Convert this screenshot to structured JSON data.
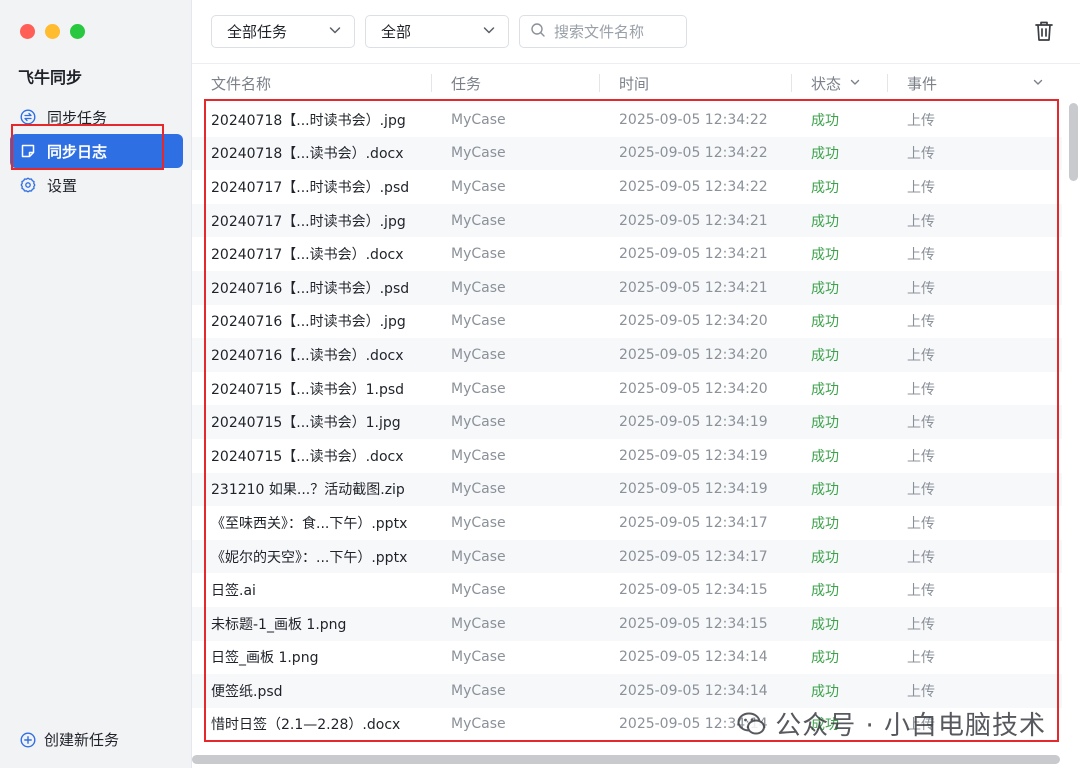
{
  "app": {
    "title": "飞牛同步"
  },
  "sidebar": {
    "items": [
      {
        "label": "同步任务",
        "icon": "sync-circle-icon",
        "active": false
      },
      {
        "label": "同步日志",
        "icon": "log-note-icon",
        "active": true
      },
      {
        "label": "设置",
        "icon": "gear-icon",
        "active": false
      }
    ],
    "create_label": "创建新任务"
  },
  "toolbar": {
    "task_filter": "全部任务",
    "status_filter": "全部",
    "search_placeholder": "搜索文件名称"
  },
  "table": {
    "columns": [
      "文件名称",
      "任务",
      "时间",
      "状态",
      "事件"
    ],
    "rows": [
      {
        "name": "20240718【...时读书会）.jpg",
        "task": "MyCase",
        "time": "2025-09-05 12:34:22",
        "status": "成功",
        "event": "上传"
      },
      {
        "name": "20240718【...读书会）.docx",
        "task": "MyCase",
        "time": "2025-09-05 12:34:22",
        "status": "成功",
        "event": "上传"
      },
      {
        "name": "20240717【...时读书会）.psd",
        "task": "MyCase",
        "time": "2025-09-05 12:34:22",
        "status": "成功",
        "event": "上传"
      },
      {
        "name": "20240717【...时读书会）.jpg",
        "task": "MyCase",
        "time": "2025-09-05 12:34:21",
        "status": "成功",
        "event": "上传"
      },
      {
        "name": "20240717【...读书会）.docx",
        "task": "MyCase",
        "time": "2025-09-05 12:34:21",
        "status": "成功",
        "event": "上传"
      },
      {
        "name": "20240716【...时读书会）.psd",
        "task": "MyCase",
        "time": "2025-09-05 12:34:21",
        "status": "成功",
        "event": "上传"
      },
      {
        "name": "20240716【...时读书会）.jpg",
        "task": "MyCase",
        "time": "2025-09-05 12:34:20",
        "status": "成功",
        "event": "上传"
      },
      {
        "name": "20240716【...读书会）.docx",
        "task": "MyCase",
        "time": "2025-09-05 12:34:20",
        "status": "成功",
        "event": "上传"
      },
      {
        "name": "20240715【...读书会）1.psd",
        "task": "MyCase",
        "time": "2025-09-05 12:34:20",
        "status": "成功",
        "event": "上传"
      },
      {
        "name": "20240715【...读书会）1.jpg",
        "task": "MyCase",
        "time": "2025-09-05 12:34:19",
        "status": "成功",
        "event": "上传"
      },
      {
        "name": "20240715【...读书会）.docx",
        "task": "MyCase",
        "time": "2025-09-05 12:34:19",
        "status": "成功",
        "event": "上传"
      },
      {
        "name": "231210 如果...？活动截图.zip",
        "task": "MyCase",
        "time": "2025-09-05 12:34:19",
        "status": "成功",
        "event": "上传"
      },
      {
        "name": "《至味西关》：食...下午）.pptx",
        "task": "MyCase",
        "time": "2025-09-05 12:34:17",
        "status": "成功",
        "event": "上传"
      },
      {
        "name": "《妮尔的天空》：...下午）.pptx",
        "task": "MyCase",
        "time": "2025-09-05 12:34:17",
        "status": "成功",
        "event": "上传"
      },
      {
        "name": "日签.ai",
        "task": "MyCase",
        "time": "2025-09-05 12:34:15",
        "status": "成功",
        "event": "上传"
      },
      {
        "name": "未标题-1_画板 1.png",
        "task": "MyCase",
        "time": "2025-09-05 12:34:15",
        "status": "成功",
        "event": "上传"
      },
      {
        "name": "日签_画板 1.png",
        "task": "MyCase",
        "time": "2025-09-05 12:34:14",
        "status": "成功",
        "event": "上传"
      },
      {
        "name": "便签纸.psd",
        "task": "MyCase",
        "time": "2025-09-05 12:34:14",
        "status": "成功",
        "event": "上传"
      },
      {
        "name": "惜时日签（2.1—2.28）.docx",
        "task": "MyCase",
        "time": "2025-09-05 12:34:14",
        "status": "成功",
        "event": "上传"
      }
    ]
  },
  "colors": {
    "accent": "#2f6fe4",
    "success": "#3fa34d",
    "highlight": "#e5282b"
  },
  "watermark": {
    "text": "公众号 · 小白电脑技术"
  }
}
